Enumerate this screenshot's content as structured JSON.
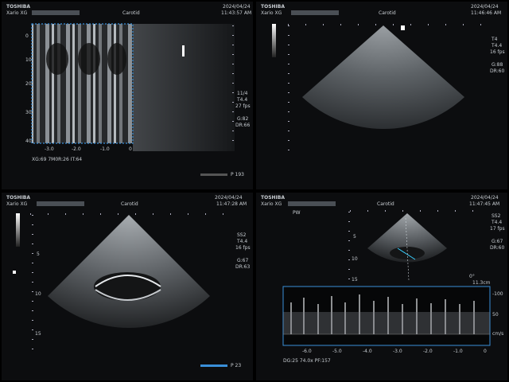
{
  "panels": [
    {
      "brand": "TOSHIBA",
      "preset": "Xario XG",
      "exam": "Carotid",
      "date": "2024/04/24",
      "time": "11:43:57 AM",
      "mmode_info": "XG:69  7M0R:26  IT:64",
      "right_params": [
        "11/4",
        "T4.4",
        "27 fps",
        "G:82",
        "DR:66"
      ],
      "depth_labels": [
        "0",
        "10",
        "20",
        "30",
        "40"
      ],
      "time_labels": [
        "-3.0",
        "-2.0",
        "-1.0",
        "0"
      ],
      "frame": "P 193"
    },
    {
      "brand": "TOSHIBA",
      "preset": "Xario XG",
      "exam": "Carotid",
      "date": "2024/04/24",
      "time": "11:46:46 AM",
      "right_params": [
        "T4",
        "T4.4",
        "16 fps",
        "G:88",
        "DR:60"
      ]
    },
    {
      "brand": "TOSHIBA",
      "preset": "Xario XG",
      "exam": "Carotid",
      "date": "2024/04/24",
      "time": "11:47:28 AM",
      "right_params": [
        "SS2",
        "T4.4",
        "16 fps",
        "G:67",
        "DR:63"
      ],
      "depth_labels": [
        "5",
        "10",
        "15"
      ],
      "frame": "P 23"
    },
    {
      "brand": "TOSHIBA",
      "preset": "Xario XG",
      "exam": "Carotid",
      "date": "2024/04/24",
      "time": "11:47:45 AM",
      "pw_label": "PW",
      "right_params": [
        "SS2",
        "T4.4",
        "17 fps",
        "G:67",
        "DR:60"
      ],
      "depth_labels": [
        "5",
        "10",
        "15"
      ],
      "angle": "0°",
      "gate": "11.3cm",
      "velocity_labels": [
        "-100",
        "50",
        "cm/s"
      ],
      "time_labels": [
        "-6.0",
        "-5.0",
        "-4.0",
        "-3.0",
        "-2.0",
        "-1.0",
        "0"
      ],
      "doppler_info": "DG:25  74.0x  PF:157"
    }
  ]
}
